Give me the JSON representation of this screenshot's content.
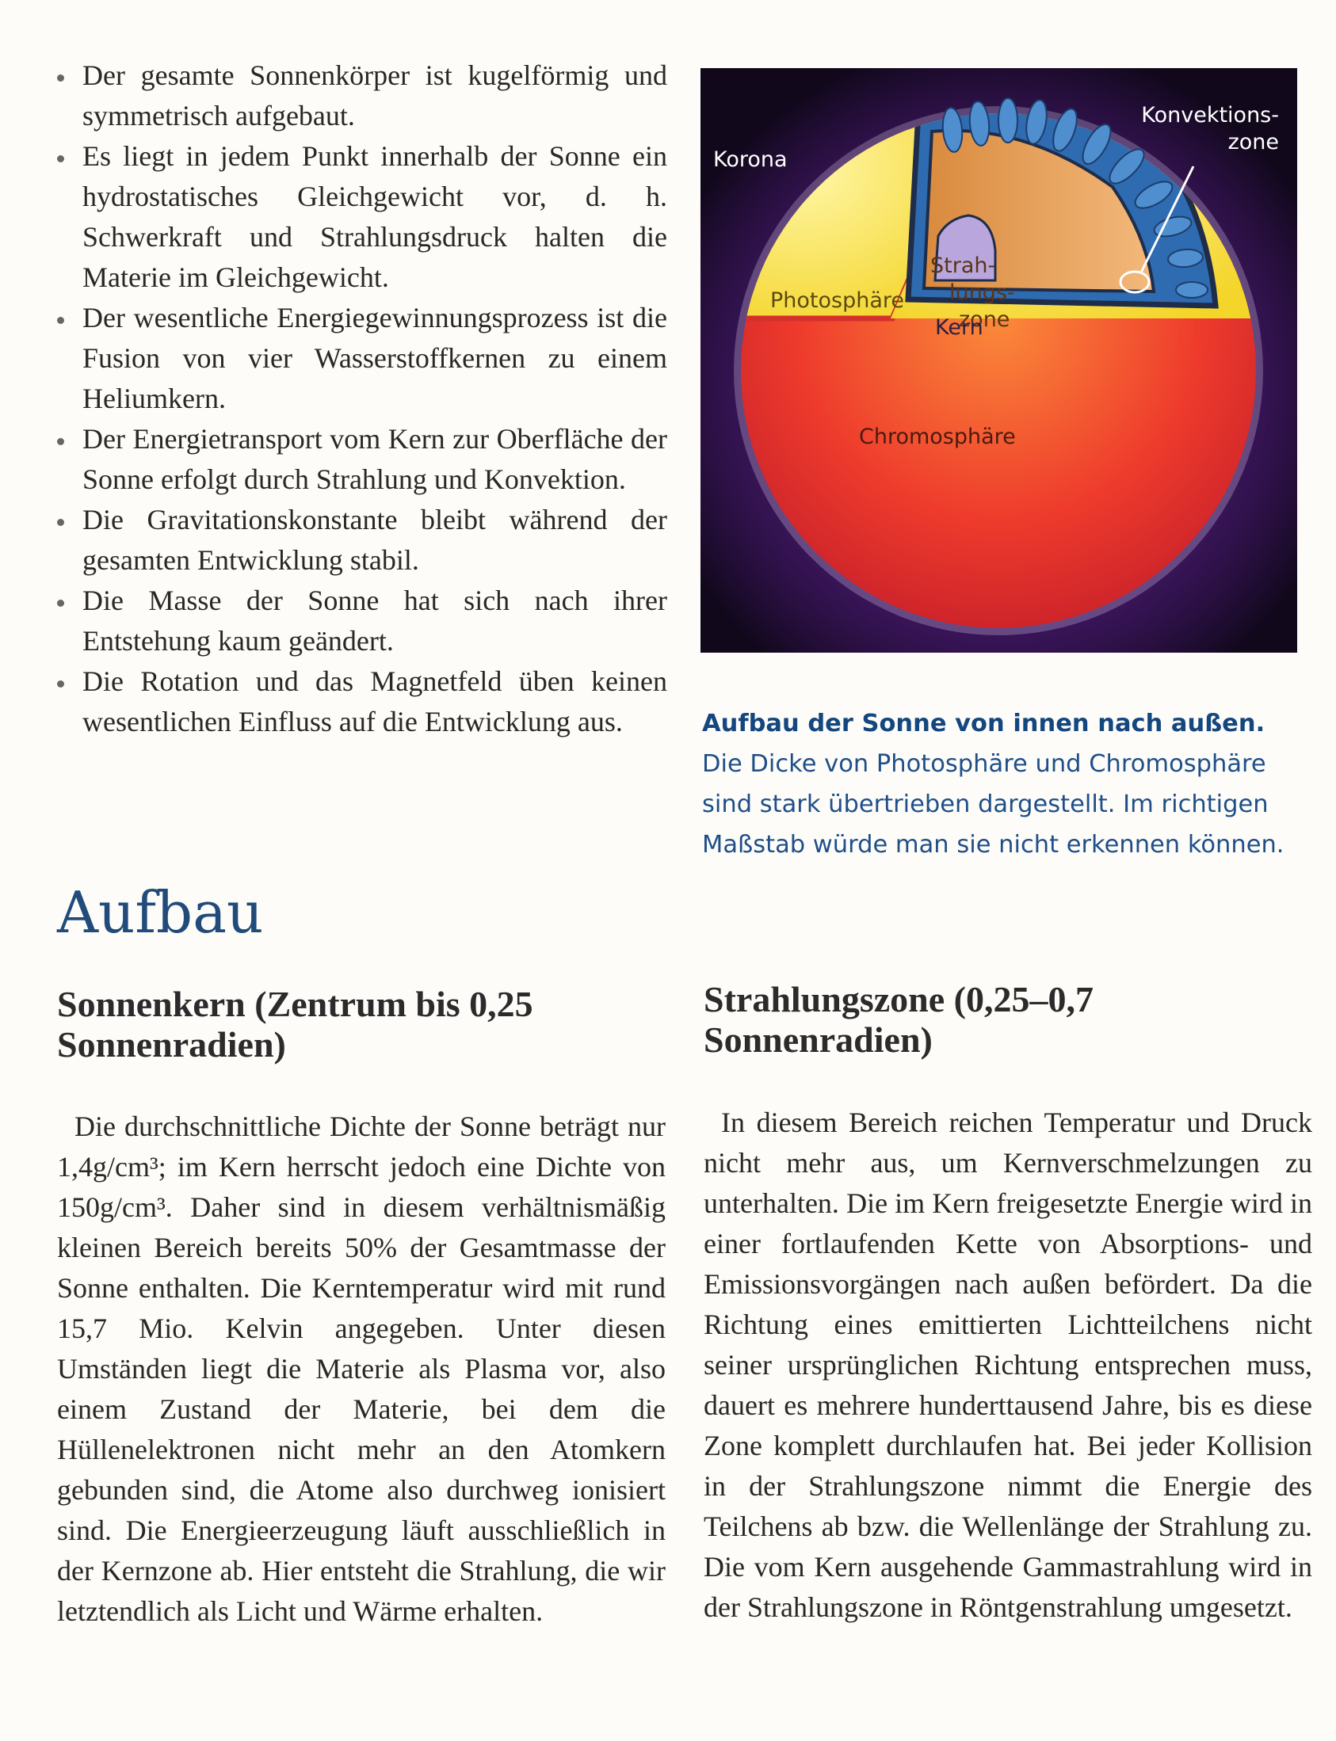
{
  "bullets": [
    "Der gesamte Sonnenkörper ist kugelförmig und symmetrisch aufgebaut.",
    "Es liegt in jedem Punkt innerhalb der Sonne ein hydrostatisches Gleichgewicht vor, d. h. Schwerkraft und Strahlungsdruck halten die Materie im Gleichgewicht.",
    "Der wesentliche Energiegewinnungsprozess ist die Fusion von vier Wasserstoffkernen zu einem Heliumkern.",
    "Der Energietransport vom Kern zur Oberfläche der Sonne erfolgt durch Strahlung und Konvektion.",
    "Die Gravitationskonstante bleibt während der gesamten Entwicklung stabil.",
    "Die Masse der Sonne hat sich nach ihrer Entstehung kaum geändert.",
    "Die Rotation und das Magnetfeld üben keinen wesentlichen Einfluss auf die Entwicklung aus."
  ],
  "figure": {
    "labels": {
      "korona": "Korona",
      "konvektion_1": "Konvektions-",
      "konvektion_2": "zone",
      "strahl_1": "Strah-",
      "strahl_2": "lungs-",
      "strahl_3": "zone",
      "photosphaere": "Photosphäre",
      "kern": "Kern",
      "chromosphaere": "Chromosphäre"
    },
    "colors": {
      "chromosphere": "#e8302a",
      "photosphere": "#f6e23a",
      "convection": "#2e6bb0",
      "radiation": "#e59a4c",
      "core": "#b9a6dd",
      "background": "#11081c"
    }
  },
  "caption": {
    "bold": "Aufbau der Sonne von innen nach außen.",
    "text": " Die Dicke von Photosphäre und Chromosphäre sind stark übertrieben dargestellt. Im richtigen Maßstab würde man sie nicht erkennen können."
  },
  "section_title": "Aufbau",
  "left": {
    "heading": "Sonnenkern (Zentrum bis 0,25 Sonnenradien)",
    "paragraph": "Die durchschnittliche Dichte der Sonne beträgt nur 1,4g/cm³; im Kern herrscht jedoch eine Dichte von 150g/cm³. Daher sind in diesem verhältnismäßig kleinen Bereich bereits 50% der Gesamtmasse der Sonne enthalten. Die Kerntemperatur wird mit rund 15,7 Mio. Kelvin angegeben. Unter diesen Umständen liegt die Materie als Plasma vor, also einem Zustand der Materie, bei dem die Hüllenelektronen nicht mehr an den Atomkern gebunden sind, die Atome also durchweg ionisiert sind. Die Energieerzeugung läuft ausschließlich in der Kernzone ab. Hier entsteht die Strahlung, die wir letztendlich als Licht und Wärme erhalten."
  },
  "right": {
    "heading": "Strahlungszone (0,25–0,7 Sonnenradien)",
    "paragraph": "In diesem Bereich reichen Temperatur und Druck nicht mehr aus, um Kernverschmelzungen zu unterhalten. Die im Kern freigesetzte Energie wird in einer fortlaufenden Kette von Absorptions- und Emissionsvorgängen nach außen befördert. Da die Richtung eines emittierten Lichtteilchens nicht seiner ursprünglichen Richtung entsprechen muss, dauert es mehrere hunderttausend Jahre, bis es diese Zone komplett durchlaufen hat. Bei jeder Kollision in der Strahlungszone nimmt die Energie des Teilchens ab bzw. die Wellenlänge der Strahlung zu. Die vom Kern ausgehende Gammastrahlung wird in der Strahlungszone in Röntgenstrahlung umgesetzt."
  }
}
